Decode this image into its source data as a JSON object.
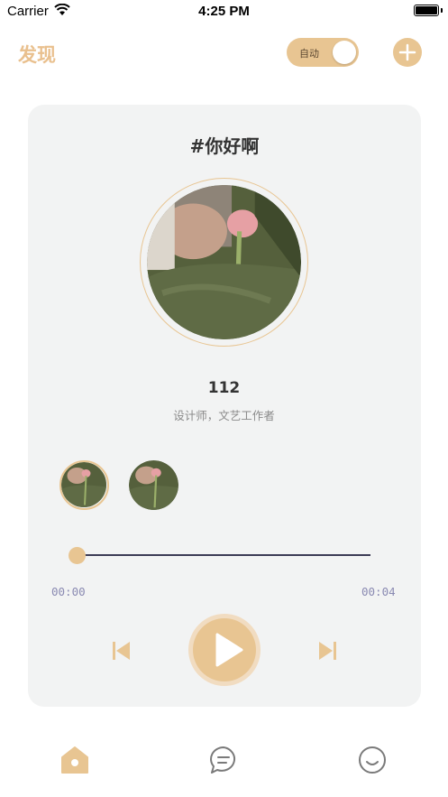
{
  "status_bar": {
    "carrier": "Carrier",
    "time": "4:25 PM"
  },
  "header": {
    "title": "发现",
    "auto_toggle_label": "自动",
    "auto_toggle_on": true
  },
  "card": {
    "title": "#你好啊",
    "count": "112",
    "bio": "设计师，文艺工作者"
  },
  "player": {
    "current_time": "00:00",
    "duration": "00:04",
    "progress": 0
  },
  "colors": {
    "accent": "#e8c592",
    "card_bg": "#f2f3f3",
    "track": "#3c3c55"
  },
  "icons": {
    "add": "plus-icon",
    "prev": "skip-previous-icon",
    "play": "play-icon",
    "next": "skip-next-icon",
    "tab_home": "home-icon",
    "tab_chat": "chat-bubble-icon",
    "tab_me": "smiley-icon"
  }
}
